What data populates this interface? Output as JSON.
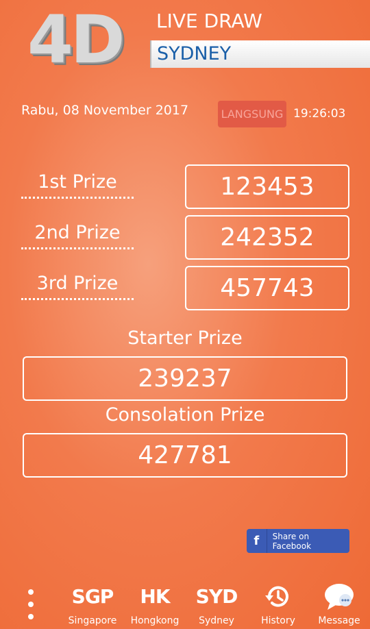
{
  "header": {
    "logo_text": "4D",
    "live_draw": "LIVE DRAW",
    "city": "SYDNEY"
  },
  "status": {
    "date": "Rabu, 08 November 2017",
    "live_badge": "LANGSUNG",
    "time": "19:26:03"
  },
  "prizes": [
    {
      "label": "1st Prize",
      "number": "123453"
    },
    {
      "label": "2nd Prize",
      "number": "242352"
    },
    {
      "label": "3rd Prize",
      "number": "457743"
    }
  ],
  "starter": {
    "title": "Starter Prize",
    "number": "239237"
  },
  "consolation": {
    "title": "Consolation Prize",
    "number": "427781"
  },
  "share": {
    "icon": "facebook-icon",
    "label": "Share on Facebook"
  },
  "nav": {
    "more_icon": "more-vertical-icon",
    "items": [
      {
        "glyph": "SGP",
        "label": "Singapore"
      },
      {
        "glyph": "HK",
        "label": "Hongkong"
      },
      {
        "glyph": "SYD",
        "label": "Sydney"
      },
      {
        "icon": "history-icon",
        "label": "History"
      },
      {
        "icon": "chat-bubble-icon",
        "label": "Message"
      }
    ]
  }
}
